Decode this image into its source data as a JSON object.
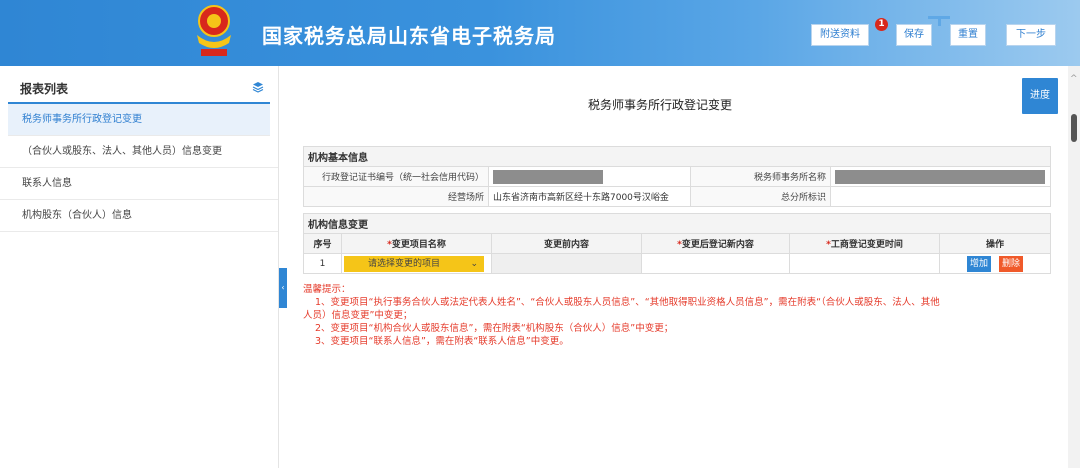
{
  "header": {
    "title": "国家税务总局山东省电子税务局",
    "buttons": {
      "attach": "附送资料",
      "save": "保存",
      "reset": "重置",
      "next": "下一步"
    },
    "attach_badge": "1",
    "brand_color": "#2f86d4"
  },
  "sidebar": {
    "title": "报表列表",
    "items": [
      {
        "label": "税务师事务所行政登记变更",
        "active": true
      },
      {
        "label": "（合伙人或股东、法人、其他人员）信息变更",
        "active": false
      },
      {
        "label": "联系人信息",
        "active": false
      },
      {
        "label": "机构股东（合伙人）信息",
        "active": false
      }
    ]
  },
  "main": {
    "form_title": "税务师事务所行政登记变更",
    "progress_label": "进度",
    "basic_section": "机构基本信息",
    "reg_no_label": "行政登记证书编号（统一社会信用代码）",
    "firm_name_label": "税务师事务所名称",
    "address_label": "经营场所",
    "address_value": "山东省济南市高新区经十东路7000号汉峪金",
    "branch_label": "总分所标识",
    "change_section": "机构信息变更",
    "columns": {
      "seq": "序号",
      "item": "变更项目名称",
      "before": "变更前内容",
      "after": "变更后登记新内容",
      "time": "工商登记变更时间",
      "ops": "操作"
    },
    "row": {
      "seq": "1",
      "select_placeholder": "请选择变更的项目",
      "add": "增加",
      "delete": "删除"
    },
    "tips": {
      "title": "温馨提示：",
      "line1": "1、变更项目“执行事务合伙人或法定代表人姓名”、“合伙人或股东人员信息”、“其他取得职业资格人员信息”，需在附表“（合伙人或股东、法人、其他",
      "line1b": "人员）信息变更”中变更；",
      "line2": "2、变更项目“机构合伙人或股东信息”，需在附表“机构股东（合伙人）信息”中变更；",
      "line3": "3、变更项目“联系人信息”，需在附表“联系人信息”中变更。"
    }
  }
}
